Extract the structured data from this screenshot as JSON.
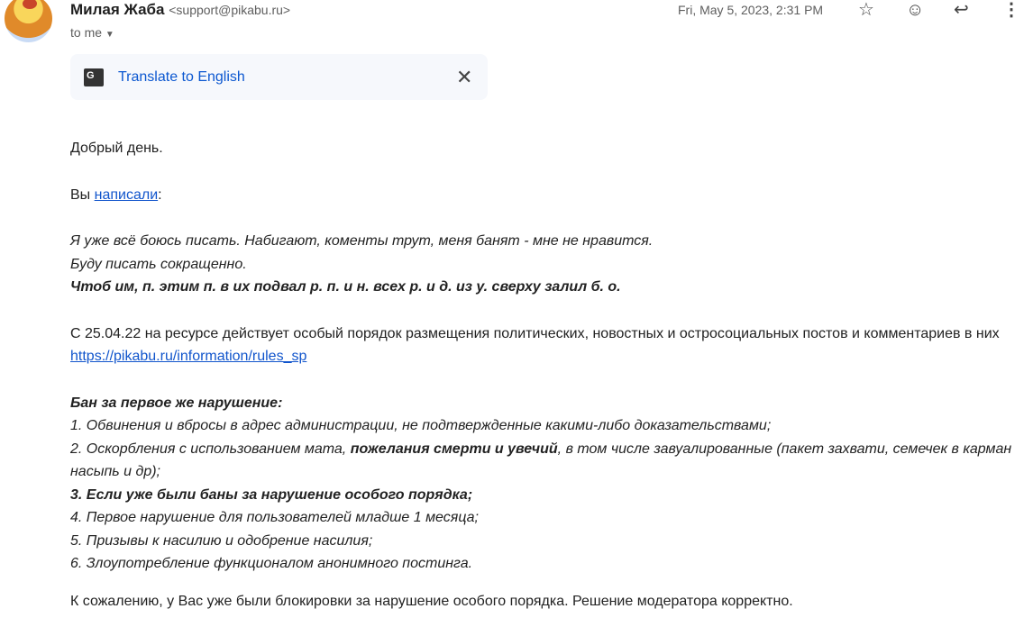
{
  "header": {
    "sender_name": "Милая Жаба",
    "sender_email": "<support@pikabu.ru>",
    "recipient": "to me",
    "date": "Fri, May 5, 2023, 2:31 PM"
  },
  "translate": {
    "label": "Translate to English"
  },
  "body": {
    "greeting": "Добрый день.",
    "wrote_prefix": "Вы ",
    "wrote_link": "написали",
    "wrote_suffix": ":",
    "quote1": "Я уже всё боюсь писать. Набигают, коменты трут, меня банят - мне не нравится.",
    "quote2": "Буду писать сокращенно.",
    "quote3": "Чтоб им, п. этим п. в их подвал р. п. и н. всех р. и д. из у. сверху залил б. о.",
    "notice": "С 25.04.22 на ресурсе действует особый порядок размещения политических, новостных и остросоциальных постов и комментариев в них ",
    "notice_link": "https://pikabu.ru/information/rules_sp",
    "ban_title": "Бан за первое же нарушение:",
    "rule1": "1. Обвинения и вбросы в адрес администрации, не подтвержденные какими-либо доказательствами;",
    "rule2a": "2. Оскорбления с использованием мата, ",
    "rule2b": "пожелания смерти и увечий",
    "rule2c": ", в том числе завуалированные (пакет захвати, семечек в карман насыпь и др);",
    "rule3": "3. Если уже были баны за нарушение особого порядка;",
    "rule4": "4. Первое нарушение для пользователей младше 1 месяца;",
    "rule5": "5. Призывы к насилию и одобрение насилия;",
    "rule6": "6. Злоупотребление функционалом анонимного постинга.",
    "conclusion": "К сожалению, у Вас уже были блокировки за нарушение особого порядка. Решение модератора корректно."
  }
}
